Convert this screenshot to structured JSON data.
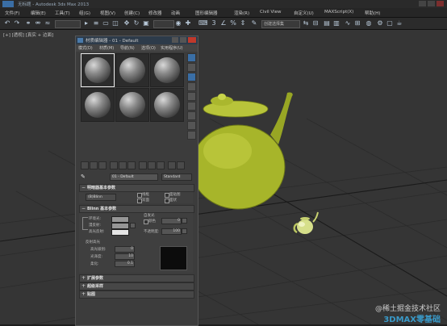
{
  "app": {
    "title": "无标题 - Autodesk 3ds Max 2013",
    "menus": [
      "文件(F)",
      "编辑(E)",
      "工具(T)",
      "组(G)",
      "视图(V)",
      "创建(C)",
      "修改器",
      "动画",
      "图形编辑器",
      "渲染(R)",
      "Civil View",
      "自定义(U)",
      "MAXScript(X)",
      "帮助(H)"
    ],
    "selection_set_placeholder": "创建选择集"
  },
  "viewport": {
    "label": "[+] [透视] [真实 + 边面]",
    "watermark_cn": "@稀土掘金技术社区",
    "watermark_brand": "3DMAX零基础",
    "colors": {
      "background": "#353535",
      "teapot": "#a7b52a"
    }
  },
  "material_editor": {
    "title": "材质编辑器 - 01 - Default",
    "menu": [
      "模式(D)",
      "材质(M)",
      "导航(N)",
      "选项(O)",
      "实用程序(U)"
    ],
    "slots_selected": 0,
    "material_name": "01 - Default",
    "material_type": "Standard",
    "shader_rollout": {
      "header": "明暗器基本参数",
      "shader": "(B)Blinn",
      "options": [
        "线框",
        "双面",
        "面贴图",
        "面状"
      ]
    },
    "blinn_rollout": {
      "header": "Blinn 基本参数",
      "self_illum_label": "自发光",
      "color_label": "颜色",
      "color_value": "0",
      "ambient_label": "环境光:",
      "diffuse_label": "漫反射:",
      "specular_label": "高光反射:",
      "opacity_label": "不透明度:",
      "opacity_value": "100",
      "spec_header": "反射高光",
      "spec_level_label": "高光级别:",
      "spec_level_value": "0",
      "gloss_label": "光泽度:",
      "gloss_value": "10",
      "soften_label": "柔化:",
      "soften_value": "0.1",
      "colors": {
        "ambient": "#969696",
        "diffuse": "#969696",
        "specular": "#e5e5e5"
      }
    },
    "collapsed_rollouts": [
      "扩展参数",
      "超级采样",
      "贴图"
    ]
  }
}
